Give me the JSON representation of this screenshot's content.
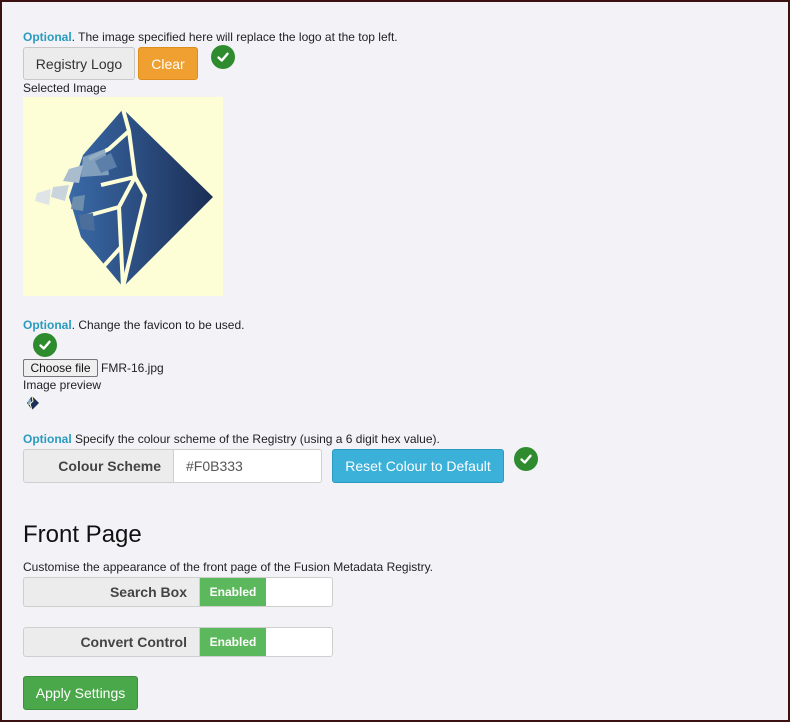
{
  "logo_section": {
    "optional_label": "Optional",
    "hint_text": ". The image specified here will replace the logo at the top left.",
    "registry_logo_button": "Registry Logo",
    "clear_button": "Clear",
    "selected_image_label": "Selected Image"
  },
  "favicon_section": {
    "optional_label": "Optional",
    "hint_text": ". Change the favicon to be used.",
    "choose_file_button": "Choose file",
    "file_name": "FMR-16.jpg",
    "image_preview_label": "Image preview"
  },
  "colour_section": {
    "optional_label": "Optional",
    "hint_text": " Specify the colour scheme of the Registry (using a 6 digit hex value).",
    "colour_scheme_label": "Colour Scheme",
    "colour_value": "#F0B333",
    "reset_button": "Reset Colour to Default"
  },
  "front_page": {
    "heading": "Front Page",
    "description": "Customise the appearance of the front page of the Fusion Metadata Registry.",
    "search_box_label": "Search Box",
    "search_box_state": "Enabled",
    "convert_control_label": "Convert Control",
    "convert_control_state": "Enabled",
    "apply_button": "Apply Settings"
  },
  "colors": {
    "optional_text": "#2a9bbf",
    "check_badge": "#2e8b2e",
    "clear_button": "#f0a030",
    "reset_button": "#3bb0d8",
    "enabled_toggle": "#5cb85c",
    "apply_button": "#4aa84a"
  }
}
